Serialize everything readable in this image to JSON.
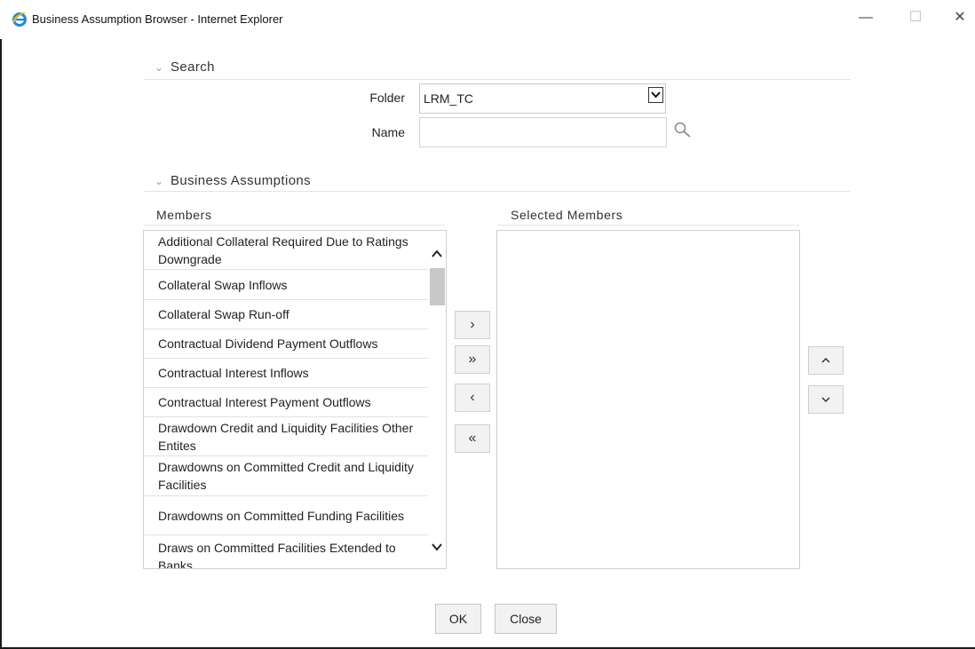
{
  "window": {
    "title": "Business Assumption Browser - Internet Explorer",
    "minimize_symbol": "—",
    "maximize_symbol": "☐",
    "close_symbol": "✕"
  },
  "search_section": {
    "title": "Search",
    "folder_label": "Folder",
    "folder_value": "LRM_TC",
    "name_label": "Name",
    "name_value": ""
  },
  "assumptions_section": {
    "title": "Business Assumptions",
    "members_header": "Members",
    "selected_header": "Selected Members",
    "members": [
      "Additional Collateral Required Due to Ratings Downgrade",
      "Collateral Swap Inflows",
      "Collateral Swap Run-off",
      "Contractual Dividend Payment Outflows",
      "Contractual Interest Inflows",
      "Contractual Interest Payment Outflows",
      "Drawdown Credit and Liquidity Facilities Other Entites",
      "Drawdowns on Committed Credit and Liquidity Facilities",
      "Drawdowns on Committed Funding Facilities",
      "Draws on Committed Facilities Extended to Banks"
    ],
    "selected_members": [],
    "move_buttons": {
      "add_one": "›",
      "add_all": "»",
      "remove_one": "‹",
      "remove_all": "«"
    },
    "order_buttons": {
      "up": "︿",
      "down": "﹀"
    }
  },
  "footer": {
    "ok_label": "OK",
    "close_label": "Close"
  },
  "colors": {
    "ie_blue": "#1e88d8",
    "ie_gold": "#f4b400",
    "border": "#cfcfcf",
    "button_bg": "#f2f2f2"
  }
}
